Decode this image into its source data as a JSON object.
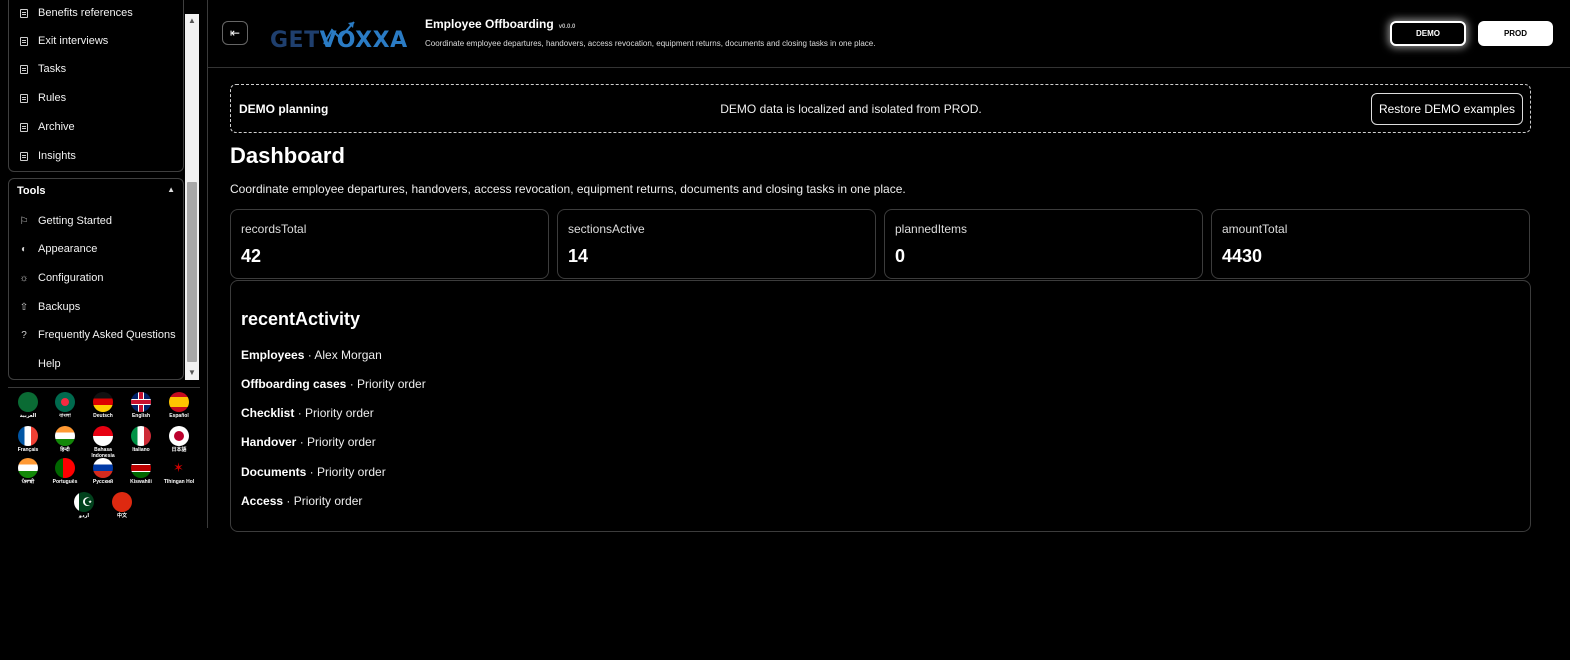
{
  "sidebar": {
    "nav_items": [
      {
        "label": "Benefits references",
        "icon": "document-icon"
      },
      {
        "label": "Exit interviews",
        "icon": "document-icon"
      },
      {
        "label": "Tasks",
        "icon": "document-icon"
      },
      {
        "label": "Rules",
        "icon": "document-icon"
      },
      {
        "label": "Archive",
        "icon": "document-icon"
      },
      {
        "label": "Insights",
        "icon": "document-icon"
      }
    ],
    "tools": {
      "title": "Tools",
      "caret": "▲",
      "items": [
        {
          "label": "Getting Started",
          "icon": "flag-icon"
        },
        {
          "label": "Appearance",
          "icon": "palette-icon"
        },
        {
          "label": "Configuration",
          "icon": "gear-icon"
        },
        {
          "label": "Backups",
          "icon": "upload-icon"
        },
        {
          "label": "Frequently Asked Questions",
          "icon": "question-icon"
        },
        {
          "label": "Help",
          "icon": ""
        }
      ]
    },
    "languages": [
      {
        "label": "العربية",
        "flag": "saudi-arabia"
      },
      {
        "label": "বাংলা",
        "flag": "bangladesh"
      },
      {
        "label": "Deutsch",
        "flag": "germany"
      },
      {
        "label": "English",
        "flag": "uk"
      },
      {
        "label": "Español",
        "flag": "spain"
      },
      {
        "label": "Français",
        "flag": "france"
      },
      {
        "label": "हिन्दी",
        "flag": "india"
      },
      {
        "label": "Bahasa Indonesia",
        "flag": "indonesia"
      },
      {
        "label": "Italiano",
        "flag": "italy"
      },
      {
        "label": "日本語",
        "flag": "japan"
      },
      {
        "label": "ਪੰਜਾਬੀ",
        "flag": "india"
      },
      {
        "label": "Português",
        "flag": "portugal"
      },
      {
        "label": "Русский",
        "flag": "russia"
      },
      {
        "label": "Kiswahili",
        "flag": "kenya"
      },
      {
        "label": "Tlhingan Hol",
        "flag": "klingon"
      },
      {
        "label": "اردو",
        "flag": "pakistan"
      },
      {
        "label": "中文",
        "flag": "china"
      }
    ]
  },
  "header": {
    "logo": "GETVOXXA",
    "title": "Employee Offboarding",
    "version": "v0.0.0",
    "subtitle": "Coordinate employee departures, handovers, access revocation, equipment returns, documents and closing tasks in one place.",
    "env_demo": "DEMO",
    "env_prod": "PROD"
  },
  "banner": {
    "title": "DEMO planning",
    "message": "DEMO data is localized and isolated from PROD.",
    "restore_label": "Restore DEMO examples"
  },
  "page": {
    "title": "Dashboard",
    "description": "Coordinate employee departures, handovers, access revocation, equipment returns, documents and closing tasks in one place."
  },
  "stats": [
    {
      "label": "recordsTotal",
      "value": "42"
    },
    {
      "label": "sectionsActive",
      "value": "14"
    },
    {
      "label": "plannedItems",
      "value": "0"
    },
    {
      "label": "amountTotal",
      "value": "4430"
    }
  ],
  "activity": {
    "title": "recentActivity",
    "rows": [
      {
        "section": "Employees",
        "detail": " · Alex Morgan"
      },
      {
        "section": "Offboarding cases",
        "detail": " · Priority order"
      },
      {
        "section": "Checklist",
        "detail": " · Priority order"
      },
      {
        "section": "Handover",
        "detail": " · Priority order"
      },
      {
        "section": "Documents",
        "detail": " · Priority order"
      },
      {
        "section": "Access",
        "detail": " · Priority order"
      }
    ]
  }
}
